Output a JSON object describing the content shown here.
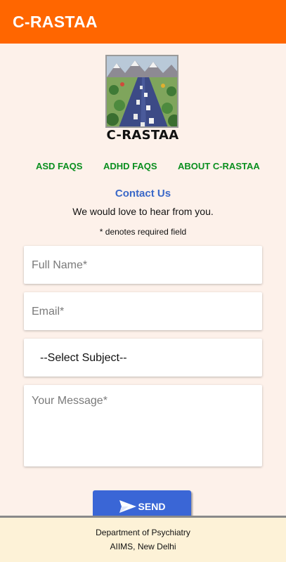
{
  "appbar": {
    "title": "C-RASTAA"
  },
  "logo": {
    "caption": "C-RASTAA"
  },
  "nav": {
    "asd_faqs": "ASD FAQS",
    "adhd_faqs": "ADHD FAQS",
    "about": "ABOUT C-RASTAA"
  },
  "contact": {
    "title": "Contact Us",
    "subtitle": "We would love to hear from you.",
    "required_note": "* denotes required field"
  },
  "form": {
    "full_name_placeholder": "Full Name*",
    "email_placeholder": "Email*",
    "subject_selected": "--Select Subject--",
    "message_placeholder": "Your Message*",
    "send_label": "SEND"
  },
  "footer": {
    "line1": "Department of Psychiatry",
    "line2": "AIIMS, New Delhi"
  },
  "colors": {
    "appbar": "#ff6600",
    "background": "#fdf1ea",
    "link_green": "#0a8f1f",
    "contact_blue": "#3a68c8",
    "send_button": "#3a66d6",
    "footer_bg": "#fdf2d7"
  },
  "icons": {
    "send": "send-icon",
    "subject_dropdown": "chevron-down-icon"
  }
}
